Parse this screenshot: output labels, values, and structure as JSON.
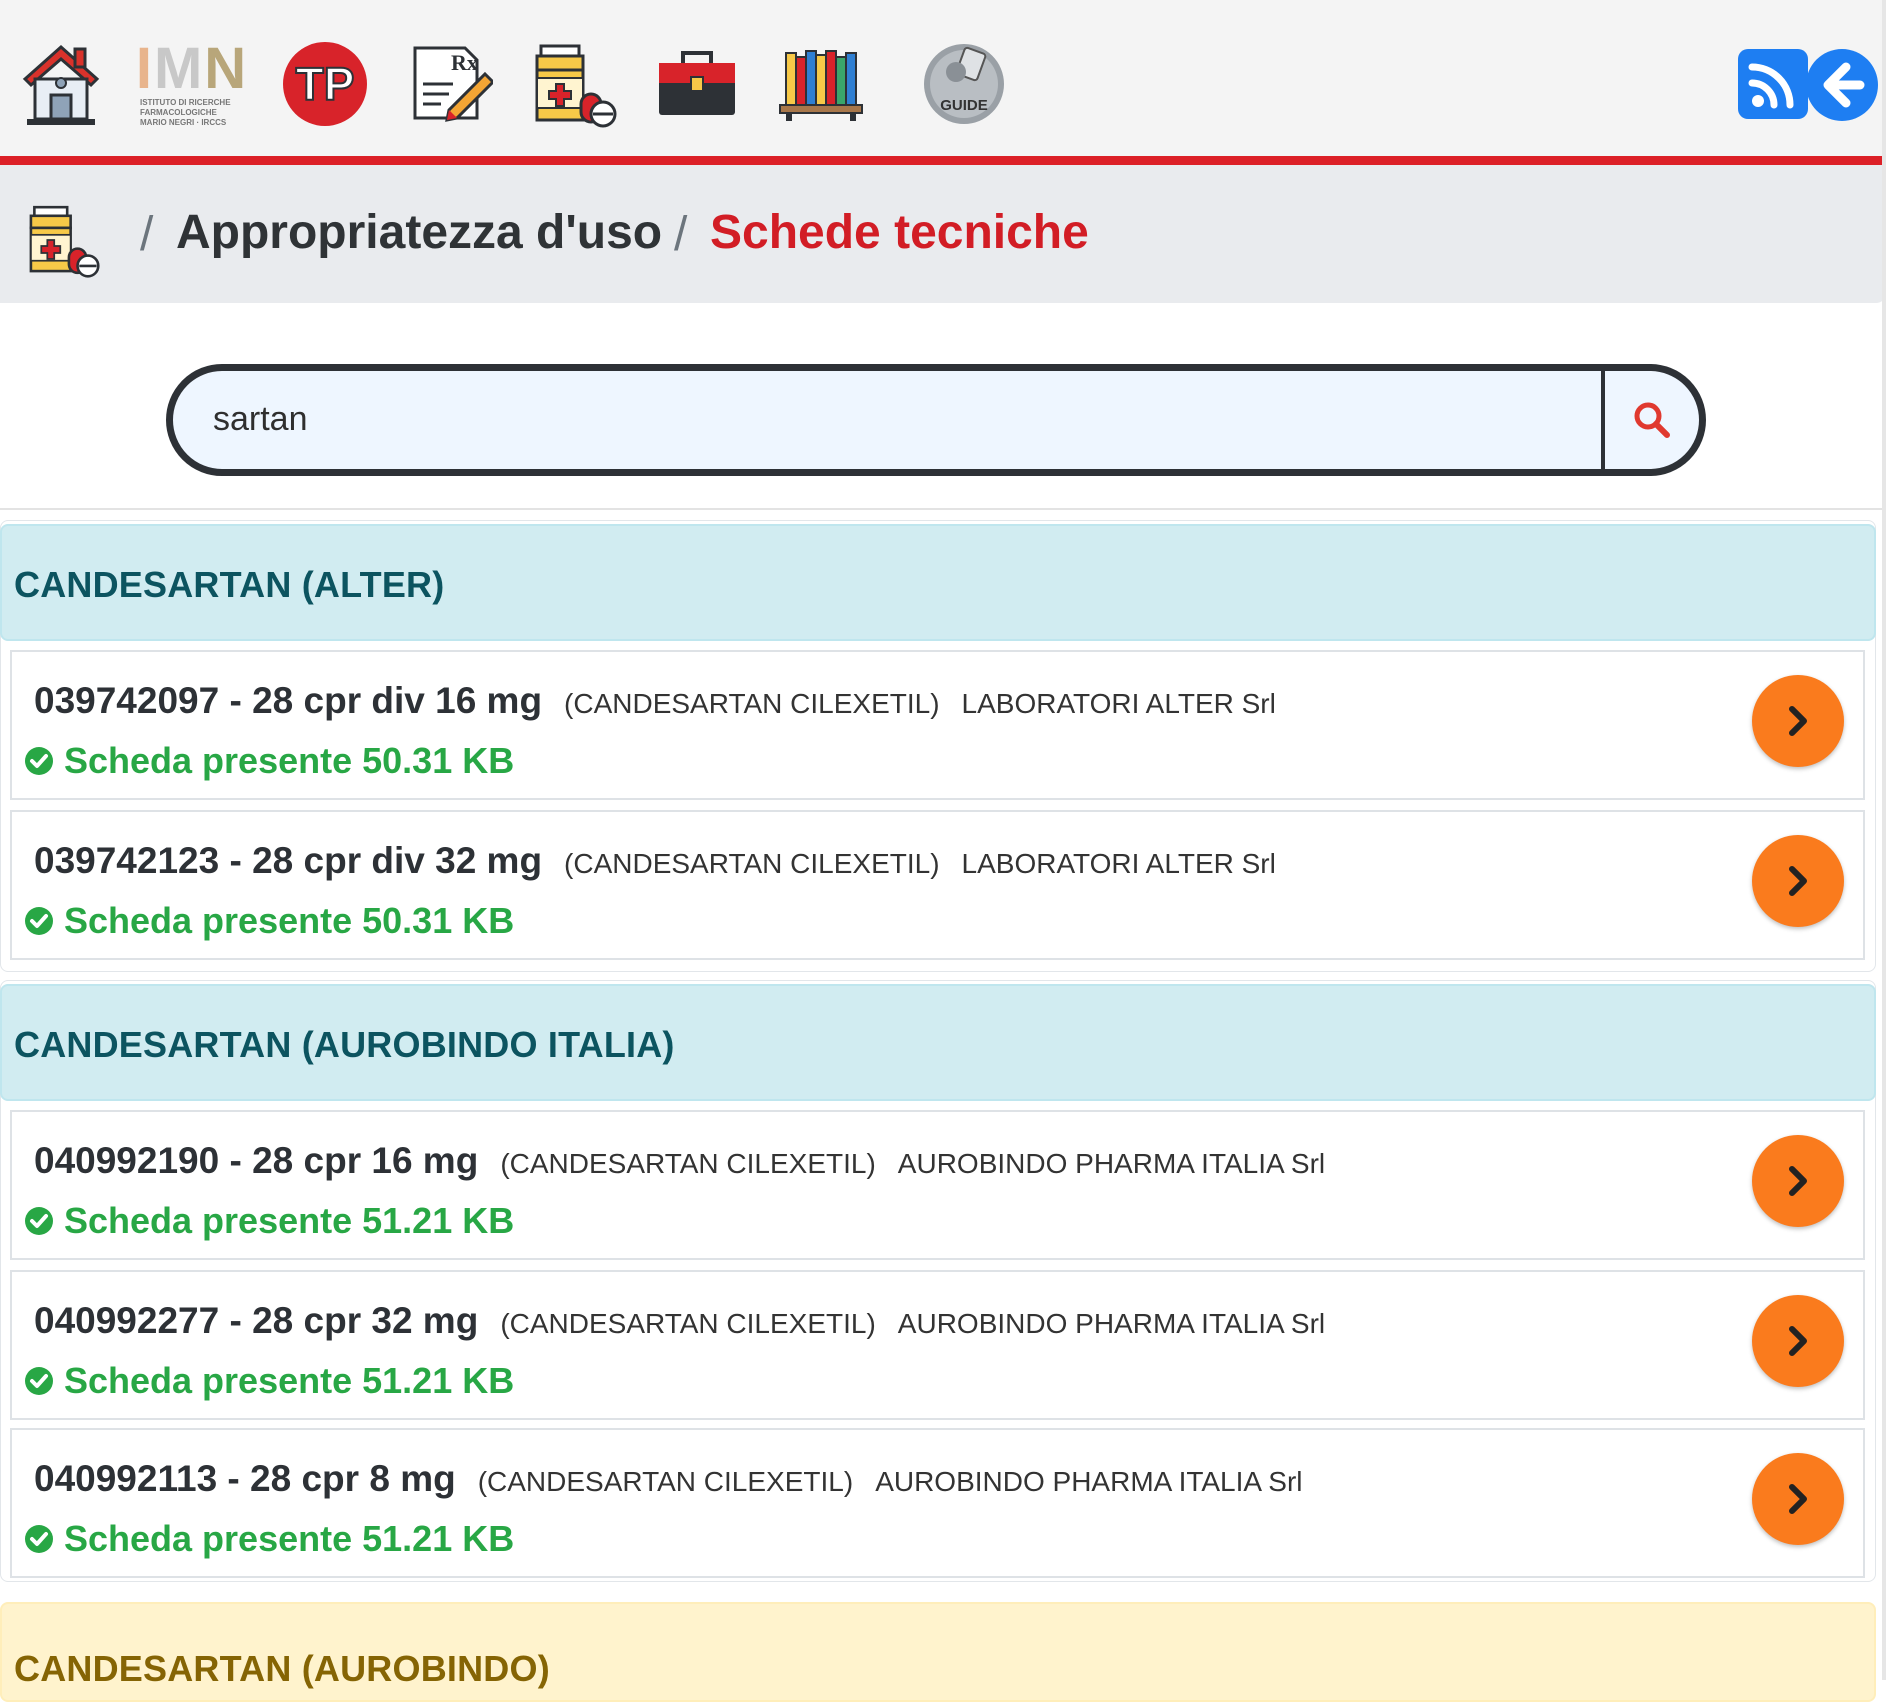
{
  "toolbar": {
    "icons": [
      {
        "name": "home-icon"
      },
      {
        "name": "imn-logo",
        "logo_text": "IMN",
        "logo_subtext": "ISTITUTO DI RICERCHE FARMACOLOGICHE MARIO NEGRI · IRCCS"
      },
      {
        "name": "tp-logo",
        "logo_text": "TP"
      },
      {
        "name": "prescription-icon"
      },
      {
        "name": "medicine-icon"
      },
      {
        "name": "toolbox-icon"
      },
      {
        "name": "library-icon"
      },
      {
        "name": "guide-icon",
        "label": "GUIDE"
      }
    ],
    "right_buttons": [
      "rss-icon",
      "back-arrow-icon"
    ],
    "colors": {
      "accent_line": "#dc2027",
      "button_blue": "#1e7ef2"
    }
  },
  "breadcrumb": {
    "separator": "/",
    "items": [
      "Appropriatezza d'uso",
      "Schede tecniche"
    ],
    "icon": "medicine-icon"
  },
  "search": {
    "value": "sartan",
    "button_icon": "search-icon"
  },
  "colors": {
    "status_green": "#28a745",
    "arrow_orange": "#fa7b1d",
    "group_info_bg": "#d1ecf1",
    "group_warning_bg": "#fff3cd",
    "current_red": "#d21d25"
  },
  "groups": [
    {
      "title": "CANDESARTAN (ALTER)",
      "items": [
        {
          "code_desc": "039742097 - 28 cpr div 16 mg",
          "substance": "(CANDESARTAN CILEXETIL)",
          "company": "LABORATORI ALTER Srl",
          "status": "Scheda presente 50.31 KB"
        },
        {
          "code_desc": "039742123 - 28 cpr div 32 mg",
          "substance": "(CANDESARTAN CILEXETIL)",
          "company": "LABORATORI ALTER Srl",
          "status": "Scheda presente 50.31 KB"
        }
      ]
    },
    {
      "title": "CANDESARTAN (AUROBINDO ITALIA)",
      "items": [
        {
          "code_desc": "040992190 - 28 cpr 16 mg",
          "substance": "(CANDESARTAN CILEXETIL)",
          "company": "AUROBINDO PHARMA ITALIA Srl",
          "status": "Scheda presente 51.21 KB"
        },
        {
          "code_desc": "040992277 - 28 cpr 32 mg",
          "substance": "(CANDESARTAN CILEXETIL)",
          "company": "AUROBINDO PHARMA ITALIA Srl",
          "status": "Scheda presente 51.21 KB"
        },
        {
          "code_desc": "040992113 - 28 cpr 8 mg",
          "substance": "(CANDESARTAN CILEXETIL)",
          "company": "AUROBINDO PHARMA ITALIA Srl",
          "status": "Scheda presente 51.21 KB"
        }
      ]
    },
    {
      "title": "CANDESARTAN (AUROBINDO)",
      "items": []
    }
  ]
}
